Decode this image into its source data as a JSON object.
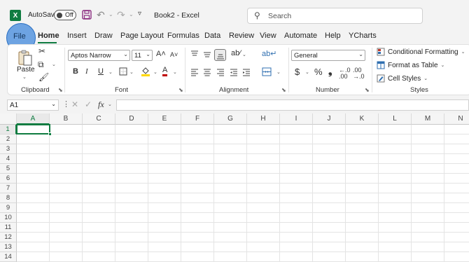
{
  "title_bar": {
    "app_logo": "X",
    "autosave_label": "AutoSave",
    "autosave_state": "Off",
    "doc_title": "Book2  -  Excel",
    "search_placeholder": "Search"
  },
  "tabs": [
    "File",
    "Home",
    "Insert",
    "Draw",
    "Page Layout",
    "Formulas",
    "Data",
    "Review",
    "View",
    "Automate",
    "Help",
    "YCharts"
  ],
  "active_tab": "Home",
  "ribbon": {
    "clipboard": {
      "paste_label": "Paste",
      "group_label": "Clipboard"
    },
    "font": {
      "font_name": "Aptos Narrow",
      "font_size": "11",
      "group_label": "Font",
      "bold": "B",
      "italic": "I",
      "underline": "U"
    },
    "alignment": {
      "group_label": "Alignment"
    },
    "number": {
      "format": "General",
      "group_label": "Number",
      "currency": "$",
      "percent": "%",
      "comma": "❟"
    },
    "styles": {
      "conditional_formatting": "Conditional Formatting",
      "format_as_table": "Format as Table",
      "cell_styles": "Cell Styles",
      "group_label": "Styles"
    }
  },
  "formula_bar": {
    "name_box": "A1",
    "fx_label": "fx",
    "value": ""
  },
  "columns": [
    "A",
    "B",
    "C",
    "D",
    "E",
    "F",
    "G",
    "H",
    "I",
    "J",
    "K",
    "L",
    "M",
    "N"
  ],
  "rows": [
    "1",
    "2",
    "3",
    "4",
    "5",
    "6",
    "7",
    "8",
    "9",
    "10",
    "11",
    "12",
    "13",
    "14"
  ],
  "selected_cell": "A1",
  "colors": {
    "accent": "#107c41",
    "highlight": "#468cdc",
    "font_red": "#c00000",
    "fill_yellow": "#ffd800"
  }
}
